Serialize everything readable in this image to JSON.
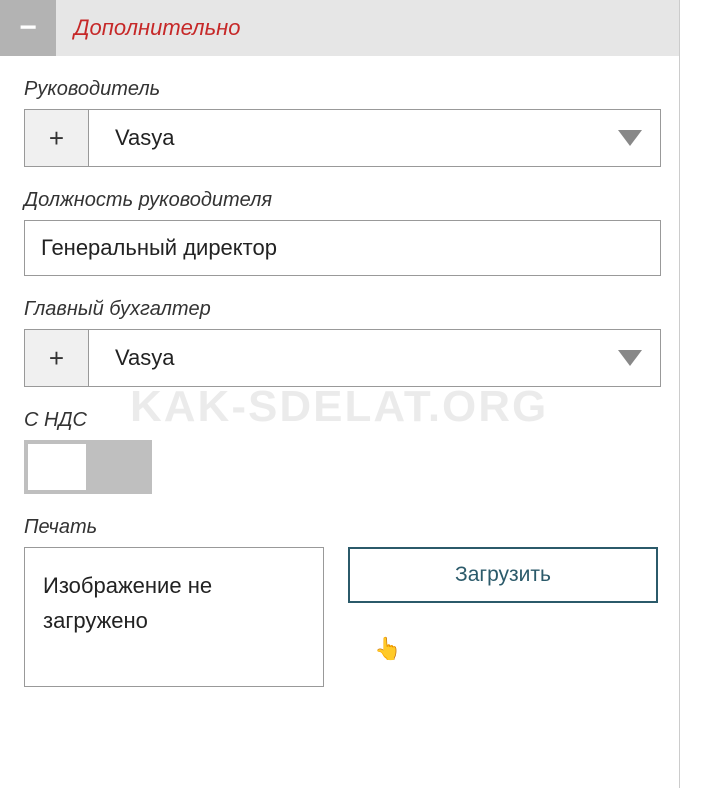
{
  "section": {
    "title": "Дополнительно",
    "collapse_icon": "−"
  },
  "fields": {
    "manager": {
      "label": "Руководитель",
      "add_icon": "+",
      "value": "Vasya"
    },
    "manager_position": {
      "label": "Должность руководителя",
      "value": "Генеральный директор"
    },
    "accountant": {
      "label": "Главный бухгалтер",
      "add_icon": "+",
      "value": "Vasya"
    },
    "vat": {
      "label": "С НДС",
      "on": false
    },
    "stamp": {
      "label": "Печать",
      "preview_text": "Изображение не загружено",
      "upload_label": "Загрузить"
    }
  },
  "watermark": "KAK-SDELAT.ORG"
}
